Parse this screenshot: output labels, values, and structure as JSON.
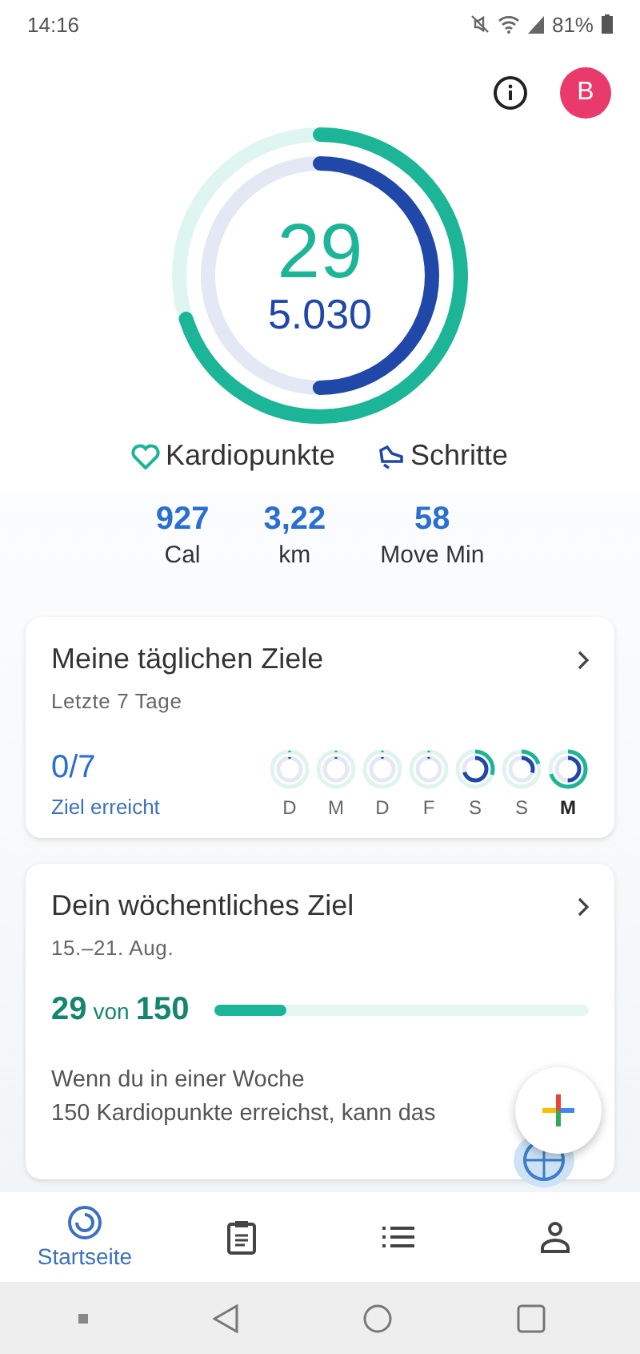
{
  "status_bar": {
    "time": "14:16",
    "battery": "81%"
  },
  "header": {
    "avatar_letter": "B"
  },
  "rings": {
    "cardio": {
      "value": "29",
      "level": 0.7
    },
    "steps": {
      "value": "5.030",
      "level": 0.5
    }
  },
  "legend": [
    {
      "kind": "cardio",
      "label": "Kardiopunkte"
    },
    {
      "kind": "steps",
      "label": "Schritte"
    }
  ],
  "stats": [
    {
      "value": "927",
      "label": "Cal"
    },
    {
      "value": "3,22",
      "label": "km"
    },
    {
      "value": "58",
      "label": "Move Min"
    }
  ],
  "daily_goals": {
    "title": "Meine täglichen Ziele",
    "subtitle": "Letzte 7 Tage",
    "count": "0/7",
    "count_label": "Ziel erreicht",
    "days": [
      {
        "label": "D",
        "selected": false
      },
      {
        "label": "M",
        "selected": false
      },
      {
        "label": "D",
        "selected": false
      },
      {
        "label": "F",
        "selected": false
      },
      {
        "label": "S",
        "selected": false,
        "cardio": {
          "level": 0.3
        },
        "steps": {
          "level": 0.7
        }
      },
      {
        "label": "S",
        "selected": false,
        "cardio": {
          "level": 0.2
        },
        "steps": {
          "level": 0.3
        }
      },
      {
        "label": "M",
        "selected": true,
        "cardio": {
          "level": 0.7
        },
        "steps": {
          "level": 0.5
        }
      }
    ]
  },
  "weekly_goal": {
    "title": "Dein wöchentliches Ziel",
    "dates": "15.–21. Aug.",
    "value": "29",
    "of": "von",
    "target": "150",
    "level": 0.19,
    "text_lines": [
      "Wenn du in einer Woche",
      "150 Kardiopunkte erreichst, kann das"
    ]
  },
  "bottom_nav": [
    {
      "kind": "home",
      "label": "Startseite",
      "selected": true
    },
    {
      "kind": "journal",
      "selected": false
    },
    {
      "kind": "list",
      "selected": false
    },
    {
      "kind": "profile",
      "selected": false
    }
  ]
}
